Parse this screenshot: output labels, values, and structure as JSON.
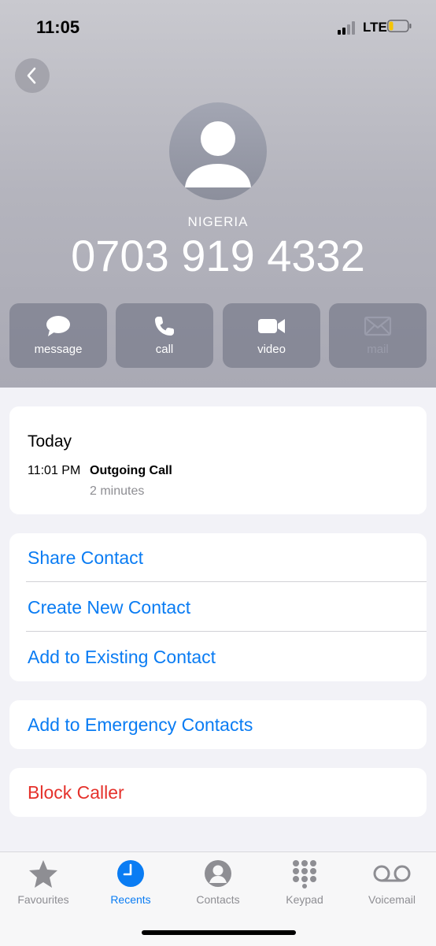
{
  "status_bar": {
    "time": "11:05",
    "network": "LTE",
    "signal_bars_active": 2,
    "signal_bars_total": 4,
    "battery_level": 0.2,
    "battery_color": "#f5c400"
  },
  "contact": {
    "label": "NIGERIA",
    "phone_number": "0703 919 4332"
  },
  "actions": [
    {
      "label": "message",
      "icon": "message-icon",
      "enabled": true
    },
    {
      "label": "call",
      "icon": "phone-icon",
      "enabled": true
    },
    {
      "label": "video",
      "icon": "video-camera-icon",
      "enabled": true
    },
    {
      "label": "mail",
      "icon": "mail-icon",
      "enabled": false
    }
  ],
  "recent": {
    "day": "Today",
    "time": "11:01 PM",
    "type": "Outgoing Call",
    "duration": "2 minutes"
  },
  "contact_options": [
    "Share Contact",
    "Create New Contact",
    "Add to Existing Contact"
  ],
  "emergency_label": "Add to Emergency Contacts",
  "block_label": "Block Caller",
  "tab_bar": {
    "tabs": [
      {
        "label": "Favourites",
        "icon": "star-icon"
      },
      {
        "label": "Recents",
        "icon": "clock-icon"
      },
      {
        "label": "Contacts",
        "icon": "person-circle-icon"
      },
      {
        "label": "Keypad",
        "icon": "keypad-icon"
      },
      {
        "label": "Voicemail",
        "icon": "voicemail-icon"
      }
    ],
    "active": "Recents"
  },
  "colors": {
    "accent": "#0a7cf3",
    "destructive": "#e5312b",
    "secondary_text": "#8e8e93",
    "background": "#f2f2f7"
  }
}
